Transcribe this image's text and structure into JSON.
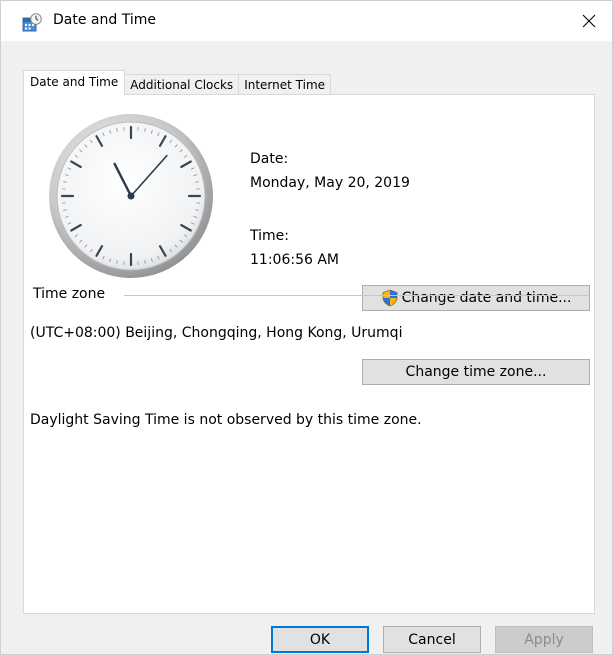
{
  "window": {
    "title": "Date and Time",
    "title_icon": "datetime-app-icon",
    "close_glyph": "✕"
  },
  "tabs": [
    {
      "label": "Date and Time",
      "active": true
    },
    {
      "label": "Additional Clocks",
      "active": false
    },
    {
      "label": "Internet Time",
      "active": false
    }
  ],
  "datetime": {
    "date_label": "Date:",
    "date_value": "Monday, May 20, 2019",
    "time_label": "Time:",
    "time_value": "11:06:56 AM",
    "change_button": "Change date and time...",
    "change_button_icon": "uac-shield-icon"
  },
  "timezone": {
    "group_label": "Time zone",
    "value": "(UTC+08:00) Beijing, Chongqing, Hong Kong, Urumqi",
    "change_button": "Change time zone...",
    "dst_note": "Daylight Saving Time is not observed by this time zone."
  },
  "footer": {
    "ok_label": "OK",
    "cancel_label": "Cancel",
    "apply_label": "Apply"
  },
  "colors": {
    "accent": "#0078d7",
    "dialog_bg": "#f0f0f0",
    "panel_bg": "#ffffff"
  }
}
